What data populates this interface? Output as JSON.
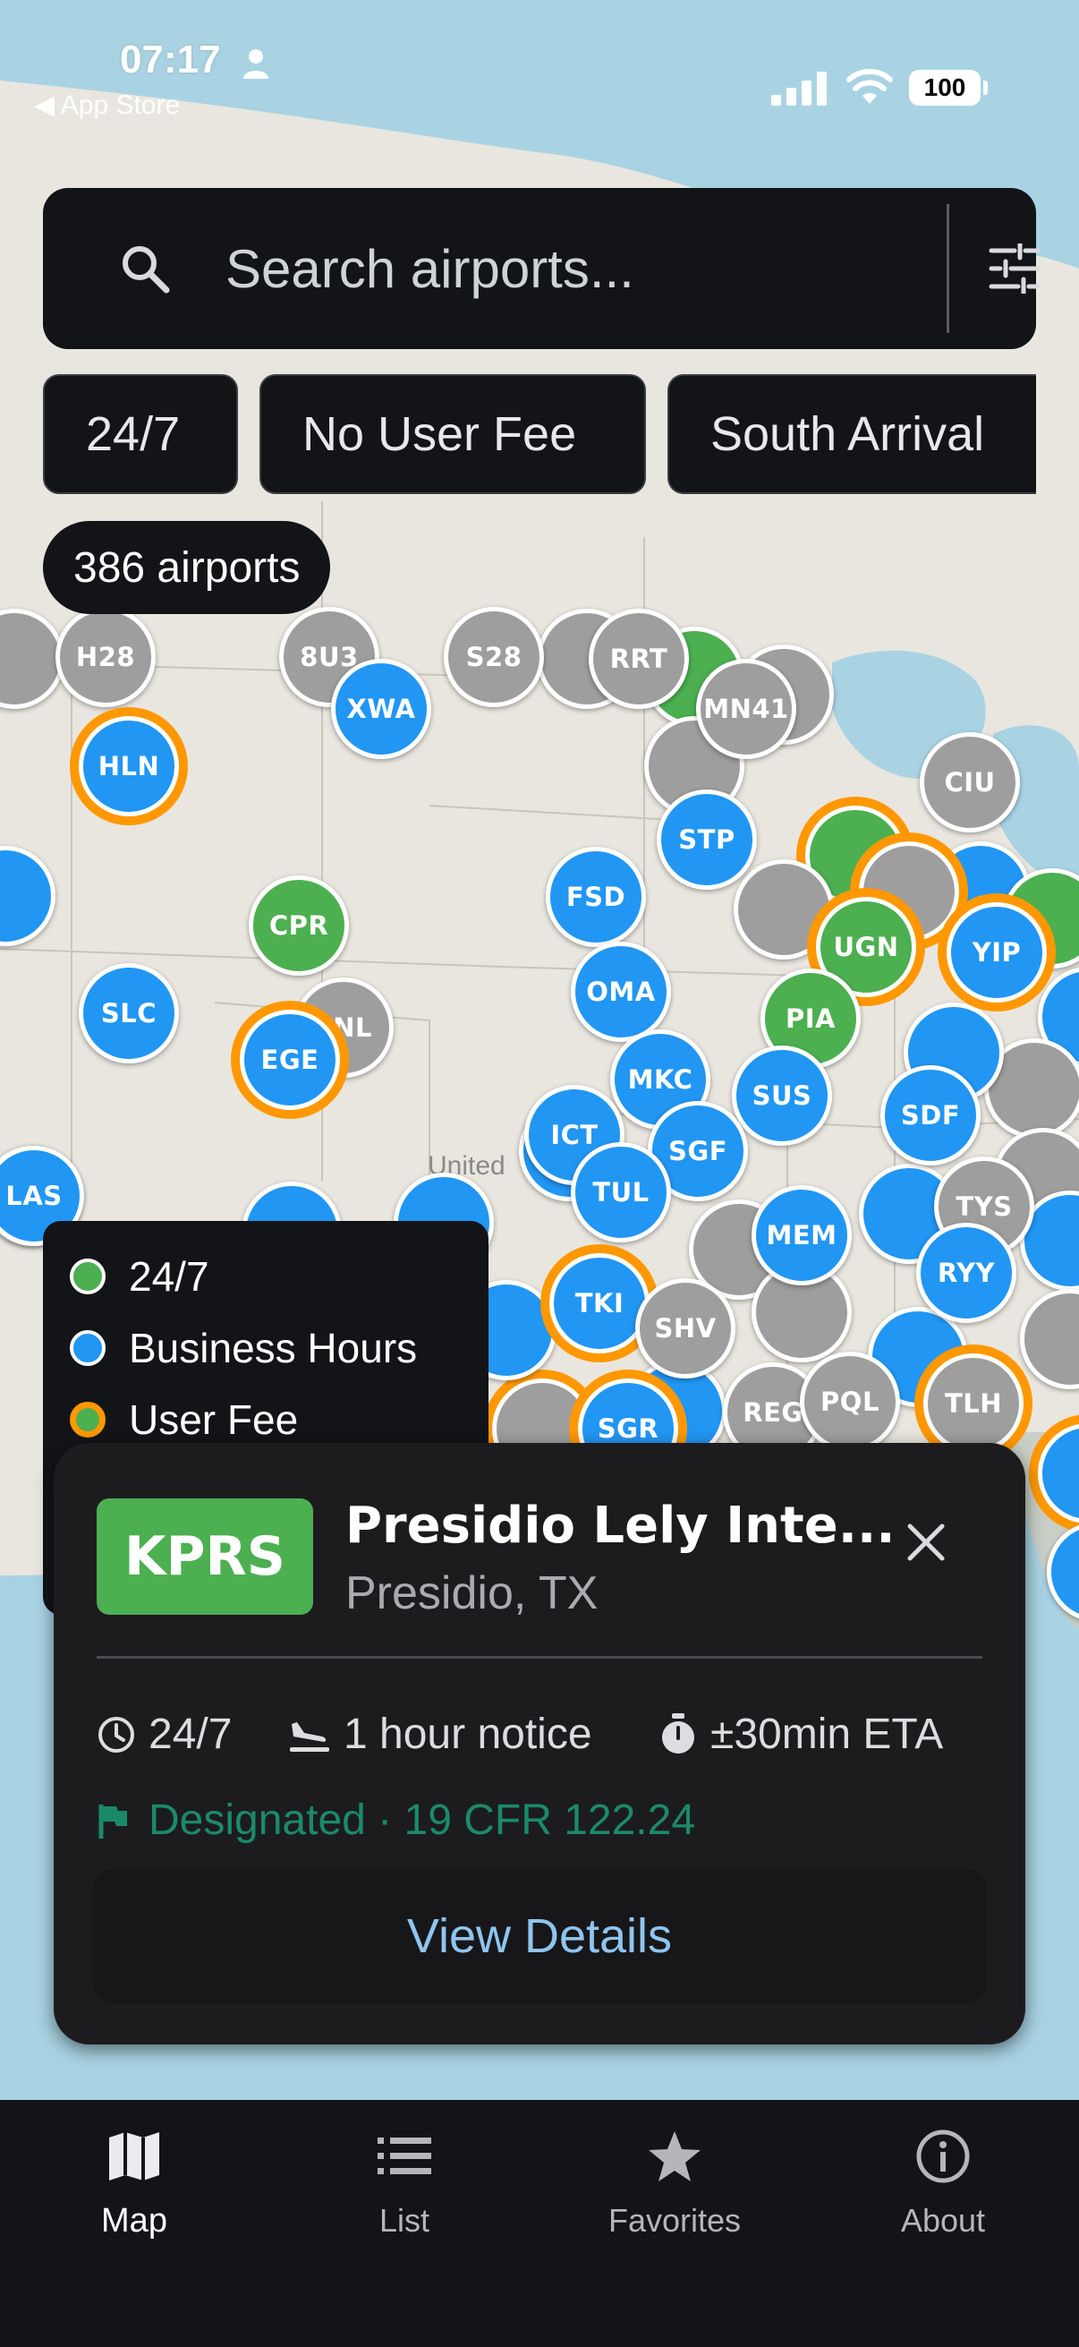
{
  "status_bar": {
    "time": "07:17",
    "back_app": "◀ App Store",
    "battery": "100"
  },
  "search": {
    "placeholder": "Search airports..."
  },
  "filters": {
    "chips": [
      "24/7",
      "No User Fee",
      "South Arrival"
    ]
  },
  "airport_count": "386 airports",
  "map": {
    "label_country": "United",
    "pins": [
      {
        "code": "H28",
        "type": "gray"
      },
      {
        "code": "8U3",
        "type": "gray"
      },
      {
        "code": "S28",
        "type": "gray"
      },
      {
        "code": "RRT",
        "type": "gray"
      },
      {
        "code": "MN41",
        "type": "gray"
      },
      {
        "code": "XWA",
        "type": "blue"
      },
      {
        "code": "HLN",
        "type": "blue"
      },
      {
        "code": "CIU",
        "type": "gray"
      },
      {
        "code": "STP",
        "type": "blue"
      },
      {
        "code": "FSD",
        "type": "blue"
      },
      {
        "code": "CPR",
        "type": "green"
      },
      {
        "code": "SLC",
        "type": "blue"
      },
      {
        "code": "FNL",
        "type": "gray"
      },
      {
        "code": "EGE",
        "type": "blue",
        "fee": true
      },
      {
        "code": "OMA",
        "type": "blue"
      },
      {
        "code": "UGN",
        "type": "green",
        "fee": true
      },
      {
        "code": "YIP",
        "type": "blue",
        "fee": true
      },
      {
        "code": "PIA",
        "type": "green"
      },
      {
        "code": "MKC",
        "type": "blue"
      },
      {
        "code": "SUS",
        "type": "blue"
      },
      {
        "code": "SDF",
        "type": "blue"
      },
      {
        "code": "ICT",
        "type": "blue"
      },
      {
        "code": "SGF",
        "type": "blue"
      },
      {
        "code": "TUL",
        "type": "blue"
      },
      {
        "code": "LAS",
        "type": "blue"
      },
      {
        "code": "MEM",
        "type": "blue"
      },
      {
        "code": "TYS",
        "type": "gray"
      },
      {
        "code": "RYY",
        "type": "blue"
      },
      {
        "code": "TKI",
        "type": "blue",
        "fee": true
      },
      {
        "code": "SHV",
        "type": "gray"
      },
      {
        "code": "REG",
        "type": "gray"
      },
      {
        "code": "PQL",
        "type": "gray"
      },
      {
        "code": "TLH",
        "type": "gray",
        "fee": true
      },
      {
        "code": "SGR",
        "type": "blue",
        "fee": true
      }
    ]
  },
  "legend": {
    "items": [
      {
        "label": "24/7",
        "color": "#4caf50"
      },
      {
        "label": "Business Hours",
        "color": "#2196f3"
      },
      {
        "label": "User Fee",
        "color": "#4caf50",
        "ring": "#ff9800"
      }
    ]
  },
  "detail_card": {
    "code": "KPRS",
    "name": "Presidio Lely Inte...",
    "location": "Presidio, TX",
    "hours": "24/7",
    "notice": "1 hour notice",
    "eta": "±30min ETA",
    "designation": "Designated · 19 CFR 122.24",
    "view_details": "View Details",
    "accent": "#4caf50"
  },
  "bottom_nav": {
    "items": [
      {
        "label": "Map",
        "icon": "map-icon"
      },
      {
        "label": "List",
        "icon": "list-icon"
      },
      {
        "label": "Favorites",
        "icon": "star-icon"
      },
      {
        "label": "About",
        "icon": "info-icon"
      }
    ]
  }
}
